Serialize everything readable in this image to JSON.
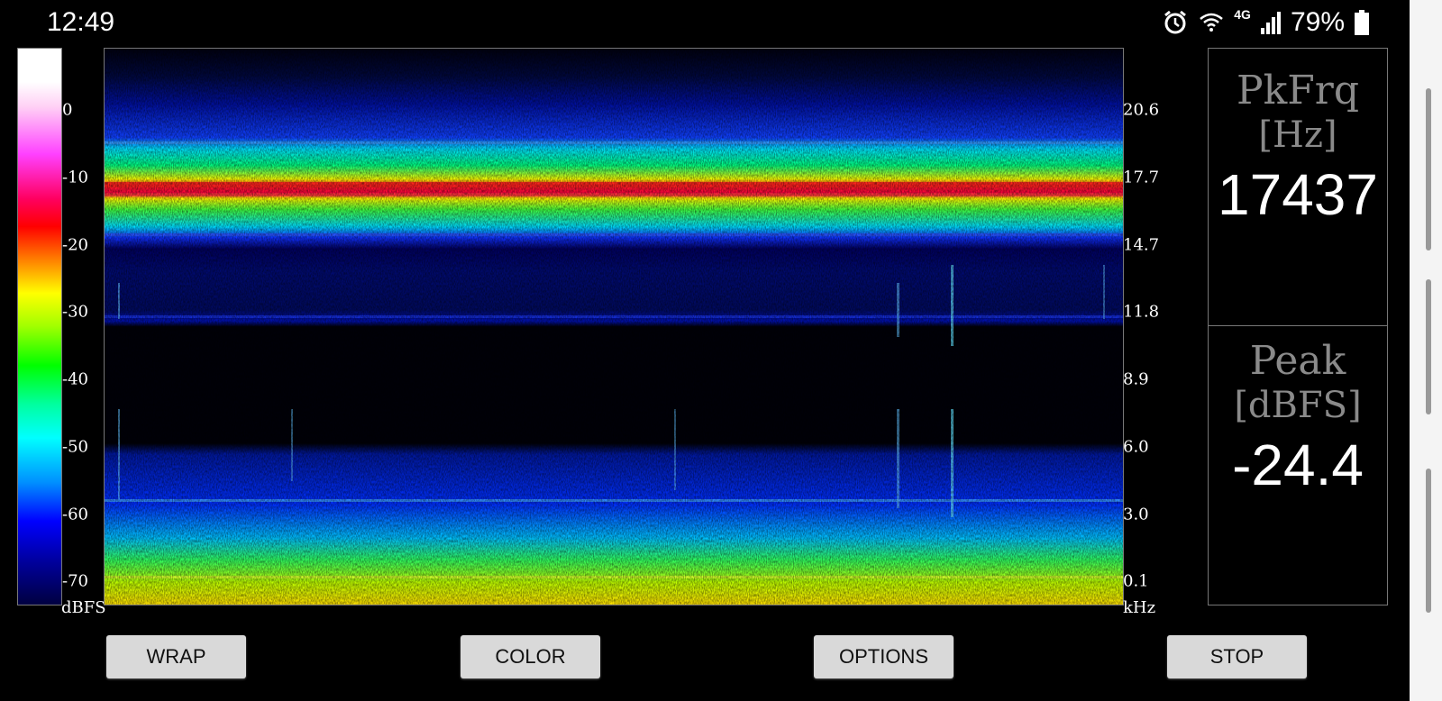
{
  "status_bar": {
    "time": "12:49",
    "network": "4G",
    "battery_pct": "79%",
    "icons": [
      "alarm-icon",
      "wifi-icon",
      "signal-icon",
      "battery-icon"
    ]
  },
  "legend": {
    "labels": [
      "0",
      "-10",
      "-20",
      "-30",
      "-40",
      "-50",
      "-60",
      "-70"
    ],
    "unit": "dBFS"
  },
  "freq_axis": {
    "labels": [
      "20.6",
      "17.7",
      "14.7",
      "11.8",
      "8.9",
      "6.0",
      "3.0",
      "0.1"
    ],
    "unit": "kHz"
  },
  "readouts": {
    "peak_freq": {
      "title": "PkFrq",
      "unit": "[Hz]",
      "value": "17437"
    },
    "peak_level": {
      "title": "Peak",
      "unit": "[dBFS]",
      "value": "-24.4"
    }
  },
  "buttons": {
    "wrap": "WRAP",
    "color": "COLOR",
    "options": "OPTIONS",
    "stop": "STOP"
  },
  "colors": {
    "background": "#000000",
    "button_bg": "#d9d9d9",
    "readout_label": "#8a8a8a"
  }
}
